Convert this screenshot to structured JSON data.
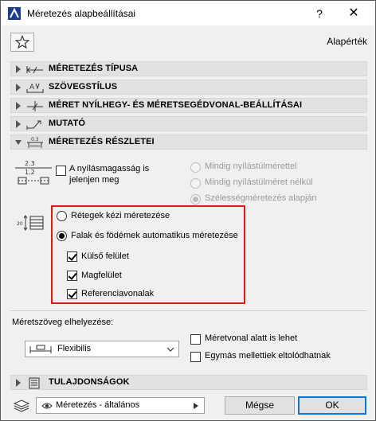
{
  "window": {
    "title": "Méretezés alapbeállításai",
    "help": "?",
    "close": "✕"
  },
  "toolbar": {
    "defaults_label": "Alapérték"
  },
  "sections": {
    "dimension_type": "MÉRETEZÉS TÍPUSA",
    "text_style": "SZÖVEGSTÍLUS",
    "arrow_settings": "MÉRET NYÍLHEGY- ÉS MÉRETSEGÉDVONAL-BEÁLLÍTÁSAI",
    "marker": "MUTATÓ",
    "details": "MÉRETEZÉS RÉSZLETEI",
    "properties": "TULAJDONSÁGOK"
  },
  "details": {
    "opening_height_line1": "A nyílásmagasság is",
    "opening_height_line2": "jelenjen meg",
    "opt_always_with": "Mindig nyílástúlmérettel",
    "opt_always_without": "Mindig nyílástúlméret nélkül",
    "opt_width_based": "Szélességméretezés alapján",
    "manual_layers": "Rétegek kézi méretezése",
    "auto_walls": "Falak és födémek automatikus méretezése",
    "outer_surface": "Külső felület",
    "core": "Magfelület",
    "reference_lines": "Referenciavonalak"
  },
  "placement": {
    "label": "Méretszöveg elhelyezése:",
    "selected": "Flexibilis",
    "below_line": "Méretvonal alatt is lehet",
    "shift_adjacent": "Egymás mellettiek eltolódhatnak"
  },
  "footer": {
    "favorite": "Méretezés - általános",
    "cancel": "Mégse",
    "ok": "OK"
  },
  "icons": {
    "app": "archicad-icon",
    "star": "star-icon"
  },
  "colors": {
    "highlight_border": "#e01818",
    "ok_border": "#0078d7"
  }
}
